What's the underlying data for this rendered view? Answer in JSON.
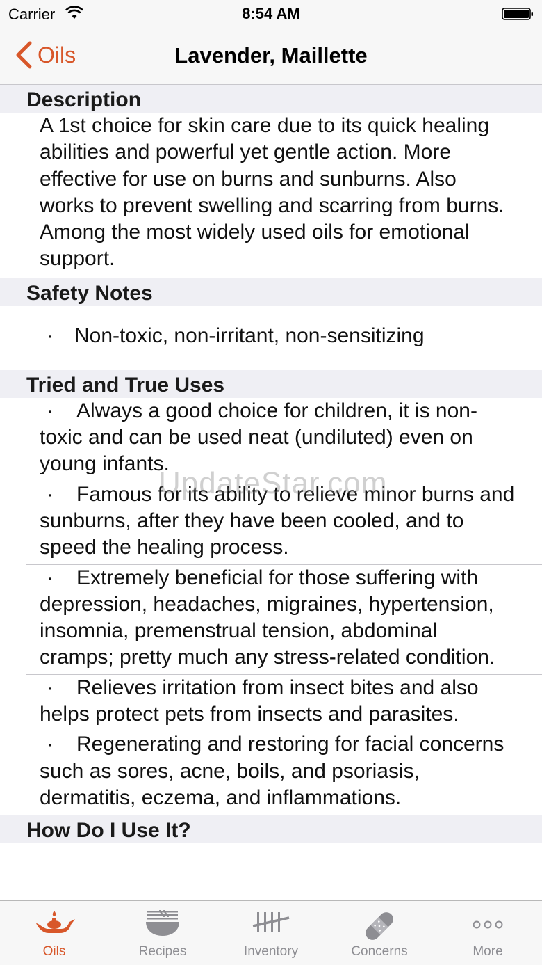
{
  "status_bar": {
    "carrier": "Carrier",
    "time": "8:54 AM"
  },
  "nav": {
    "back_label": "Oils",
    "title": "Lavender, Maillette"
  },
  "sections": {
    "description": {
      "header": "Description",
      "text": "A 1st choice for skin care due to its quick healing abilities and powerful yet gentle action. More effective for use on burns and sunburns. Also works to prevent swelling and scarring from burns. Among the most widely used oils for emotional support."
    },
    "safety": {
      "header": "Safety Notes",
      "items": [
        "Non-toxic, non-irritant, non-sensitizing"
      ]
    },
    "uses": {
      "header": "Tried and True Uses",
      "items": [
        "Always a good choice for children, it is non-toxic and can be used neat (undiluted) even on young infants.",
        "Famous for its ability to relieve minor burns and sunburns, after they have been cooled, and to speed the healing process.",
        "Extremely beneficial for those suffering with depression, headaches, migraines, hypertension, insomnia, premenstrual tension, abdominal cramps; pretty much any stress-related condition.",
        "Relieves irritation from insect bites and also helps protect pets from insects and parasites.",
        "Regenerating and restoring for facial concerns such as sores, acne, boils, and psoriasis, dermatitis, eczema, and inflammations."
      ]
    },
    "how_to_use": {
      "header": "How Do I Use It?"
    }
  },
  "bullet": "·",
  "watermark": "UpdateStar.com",
  "tabs": [
    {
      "label": "Oils",
      "icon": "oil-lamp-icon",
      "active": true
    },
    {
      "label": "Recipes",
      "icon": "bowl-icon",
      "active": false
    },
    {
      "label": "Inventory",
      "icon": "tally-icon",
      "active": false
    },
    {
      "label": "Concerns",
      "icon": "bandage-icon",
      "active": false
    },
    {
      "label": "More",
      "icon": "more-dots-icon",
      "active": false
    }
  ],
  "colors": {
    "accent": "#d8572a",
    "inactive": "#8e8e93",
    "section_bg": "#efeff4"
  }
}
